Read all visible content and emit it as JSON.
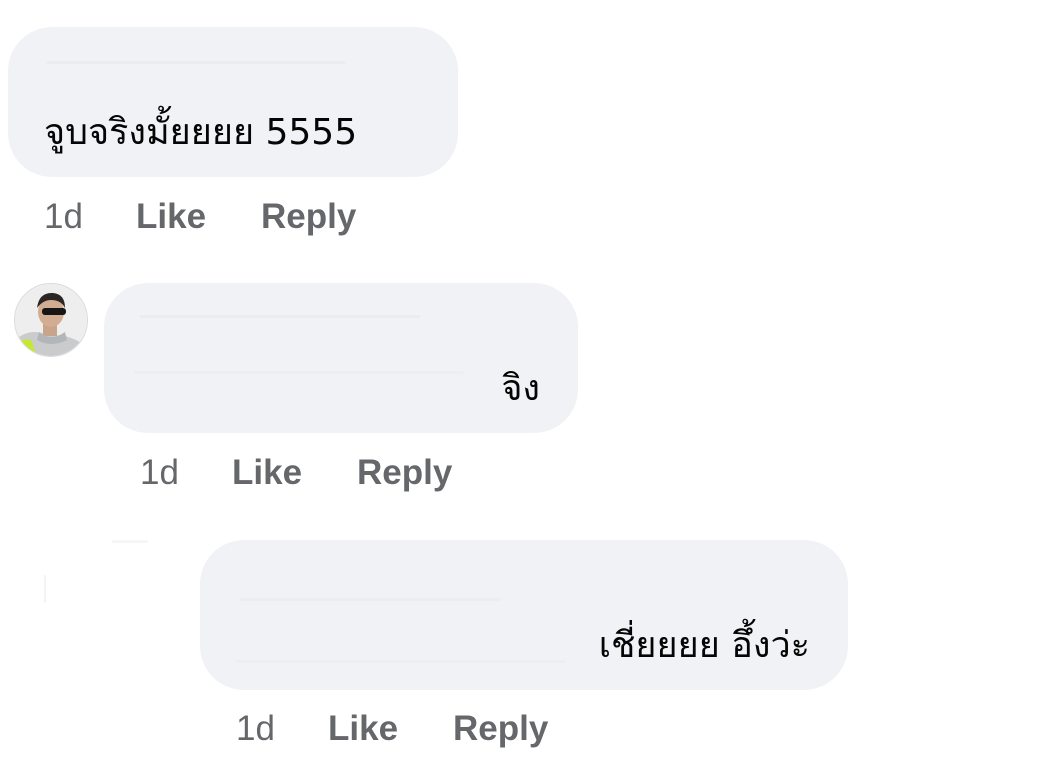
{
  "comments": [
    {
      "text": "จูบจริงมั้ยยยย 5555",
      "time": "1d",
      "like": "Like",
      "reply": "Reply"
    },
    {
      "text": "จิง",
      "time": "1d",
      "like": "Like",
      "reply": "Reply",
      "avatar_icon": "user-avatar-icon"
    },
    {
      "text": "เชี่ยยยย อึ้งว่ะ",
      "time": "1d",
      "like": "Like",
      "reply": "Reply"
    }
  ],
  "colors": {
    "bubble": "#f0f2f5",
    "text": "#050505",
    "meta": "#65676b",
    "accent": "#c6e832"
  }
}
